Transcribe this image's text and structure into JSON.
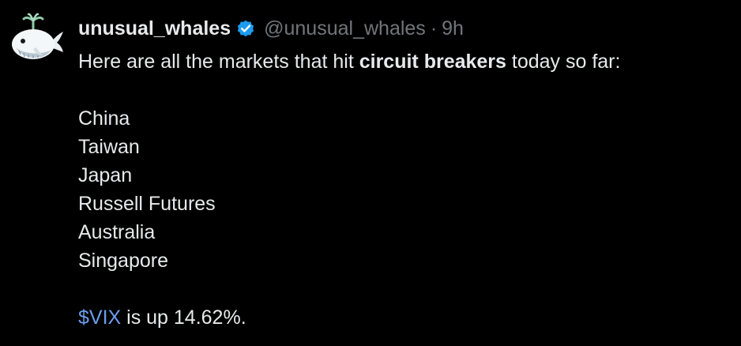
{
  "tweet": {
    "display_name": "unusual_whales",
    "handle": "@unusual_whales",
    "separator": "·",
    "time": "9h",
    "intro_before": "Here are all the markets that hit ",
    "intro_bold": "circuit breakers",
    "intro_after": " today so far:",
    "markets": [
      "China",
      "Taiwan",
      "Japan",
      "Russell Futures",
      "Australia",
      "Singapore"
    ],
    "cashtag": "$VIX",
    "closing_text": " is up 14.62%."
  },
  "icons": {
    "avatar": "whale-avatar-icon",
    "verified": "verified-badge-icon"
  },
  "colors": {
    "background": "#000000",
    "text": "#e7e9ea",
    "secondary": "#71767b",
    "link": "#6d9eeb",
    "verified": "#1d9bf0"
  }
}
